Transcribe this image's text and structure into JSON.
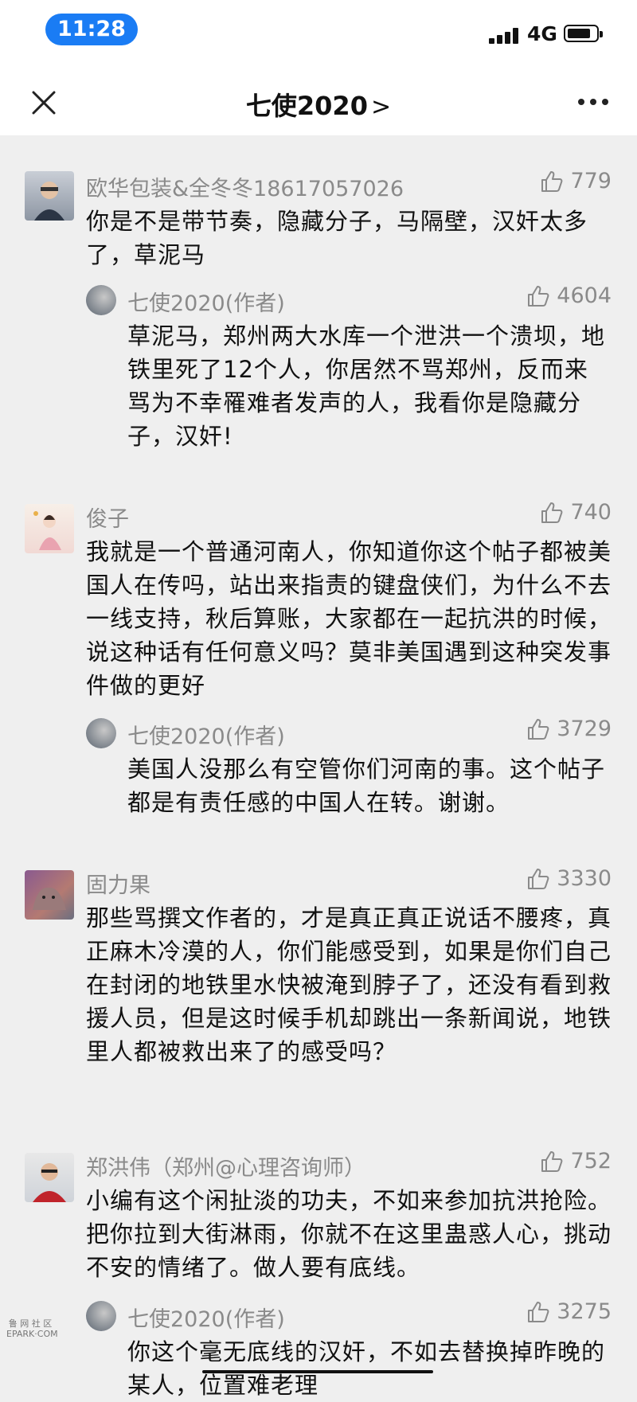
{
  "status_bar": {
    "time": "11:28",
    "network": "4G"
  },
  "nav": {
    "title": "七使2020",
    "chevron": ">"
  },
  "comments": [
    {
      "name": "欧华包装&全冬冬18617057026",
      "likes": "779",
      "text": "你是不是带节奏，隐藏分子，马隔壁，汉奸太多了，草泥马",
      "reply": {
        "name": "七使2020(作者)",
        "likes": "4604",
        "text": "草泥马，郑州两大水库一个泄洪一个溃坝，地铁里死了12个人，你居然不骂郑州，反而来骂为不幸罹难者发声的人，我看你是隐藏分子，汉奸!"
      }
    },
    {
      "name": "俊子",
      "likes": "740",
      "text": "我就是一个普通河南人，你知道你这个帖子都被美国人在传吗，站出来指责的键盘侠们，为什么不去一线支持，秋后算账，大家都在一起抗洪的时候，说这种话有任何意义吗？莫非美国遇到这种突发事件做的更好",
      "reply": {
        "name": "七使2020(作者)",
        "likes": "3729",
        "text": "美国人没那么有空管你们河南的事。这个帖子都是有责任感的中国人在转。谢谢。"
      }
    },
    {
      "name": "固力果",
      "likes": "3330",
      "text": "那些骂撰文作者的，才是真正真正说话不腰疼，真正麻木冷漠的人，你们能感受到，如果是你们自己在封闭的地铁里水快被淹到脖子了，还没有看到救援人员，但是这时候手机却跳出一条新闻说，地铁里人都被救出来了的感受吗？"
    },
    {
      "name": "郑洪伟（郑州@心理咨询师）",
      "likes": "752",
      "text": "小编有这个闲扯淡的功夫，不如来参加抗洪抢险。把你拉到大街淋雨，你就不在这里蛊惑人心，挑动不安的情绪了。做人要有底线。",
      "reply": {
        "name": "七使2020(作者)",
        "likes": "3275",
        "text": "你这个毫无底线的汉奸，不如去替换掉昨晚的某人，位置难老理"
      }
    }
  ],
  "watermark": "鲁 网 社 区 EPARK·COM"
}
